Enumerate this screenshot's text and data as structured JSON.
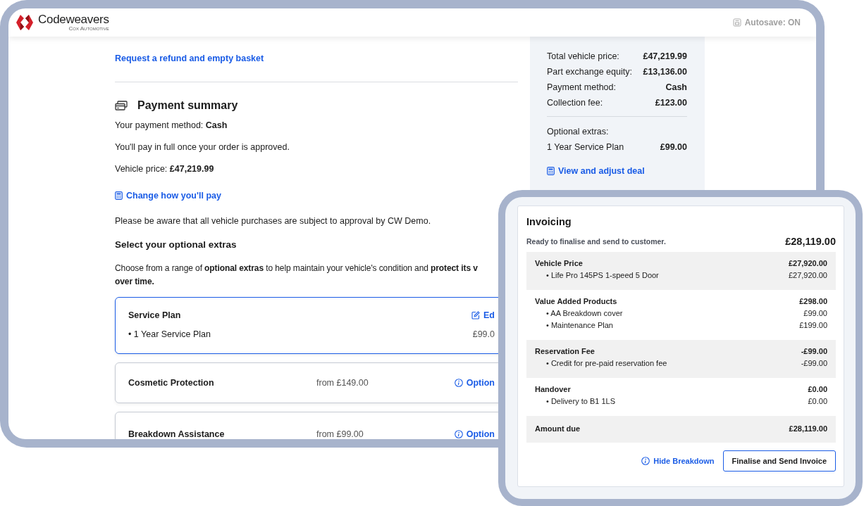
{
  "header": {
    "brand": "Codeweavers",
    "brand_sub": "Cox Automotive",
    "autosave": "Autosave: ON"
  },
  "main": {
    "refund_link": "Request a refund and empty basket",
    "payment_summary": {
      "title": "Payment summary",
      "method_line": "Your payment method: **Cash**",
      "note": "You'll pay in full once your order is approved.",
      "price_line": "Vehicle price: **£47,219.99**",
      "change_link": "Change how you'll pay",
      "approval_note": "Please be aware that all vehicle purchases are subject to approval by CW Demo."
    },
    "extras": {
      "title": "Select your optional extras",
      "intro_lines": [
        "Choose from a range of **optional extras** to help maintain your vehicle's condition and **protect its v**",
        "**over time.**"
      ],
      "cards": [
        {
          "kind": "added",
          "selected": true,
          "title": "Service Plan",
          "action": "Ed",
          "item": "• 1 Year Service Plan",
          "price": "£99.0"
        },
        {
          "kind": "offer",
          "selected": false,
          "title": "Cosmetic Protection",
          "price": "from £149.00",
          "action": "Option"
        },
        {
          "kind": "offer",
          "selected": false,
          "title": "Breakdown Assistance",
          "price": "from £99.00",
          "action": "Option"
        }
      ]
    }
  },
  "summary": {
    "rows": [
      {
        "label": "Total vehicle price:",
        "value": "£47,219.99"
      },
      {
        "label": "Part exchange equity:",
        "value": "£13,136.00"
      },
      {
        "label": "Payment method:",
        "value": "Cash"
      },
      {
        "label": "Collection fee:",
        "value": "£123.00"
      }
    ],
    "extras_label": "Optional extras:",
    "extras": [
      {
        "label": "1 Year Service Plan",
        "value": "£99.00"
      }
    ],
    "adjust_link": "View and adjust deal"
  },
  "invoice": {
    "title": "Invoicing",
    "status": "Ready to finalise and send to customer.",
    "total": "£28,119.00",
    "sections": [
      {
        "kind": "group",
        "title": "Vehicle Price",
        "amount": "£27,920.00",
        "items": [
          {
            "label": "• Life Pro 145PS 1-speed 5 Door",
            "amount": "£27,920.00"
          }
        ]
      },
      {
        "kind": "group",
        "title": "Value Added Products",
        "amount": "£298.00",
        "items": [
          {
            "label": "• AA Breakdown cover",
            "amount": "£99.00"
          },
          {
            "label": "• Maintenance Plan",
            "amount": "£199.00"
          }
        ]
      },
      {
        "kind": "group",
        "title": "Reservation Fee",
        "amount": "-£99.00",
        "items": [
          {
            "label": "• Credit for pre-paid reservation fee",
            "amount": "-£99.00"
          }
        ]
      },
      {
        "kind": "group",
        "title": "Handover",
        "amount": "£0.00",
        "items": [
          {
            "label": "• Delivery to B1 1LS",
            "amount": "£0.00"
          }
        ]
      },
      {
        "kind": "total",
        "title": "Amount due",
        "amount": "£28,119.00"
      }
    ],
    "hide_link": "Hide Breakdown",
    "send_button": "Finalise and Send Invoice"
  }
}
